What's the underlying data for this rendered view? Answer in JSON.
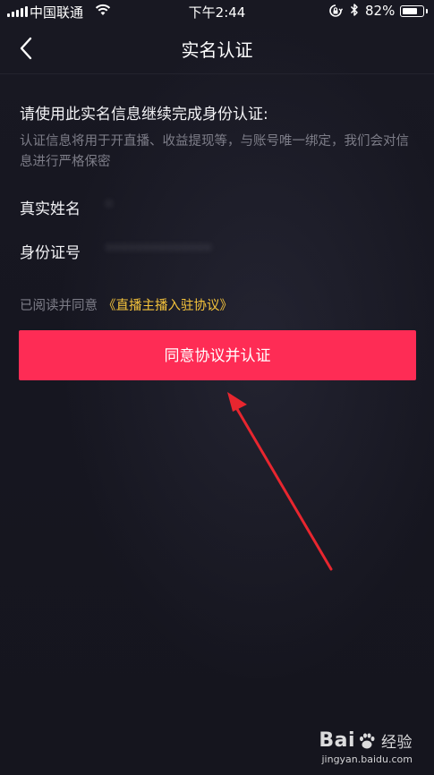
{
  "status_bar": {
    "carrier": "中国联通",
    "time": "下午2:44",
    "battery_percent": "82%",
    "battery_level": 0.82
  },
  "nav": {
    "title": "实名认证"
  },
  "main": {
    "heading": "请使用此实名信息继续完成身份认证:",
    "description": "认证信息将用于开直播、收益提现等，与账号唯一绑定，我们会对信息进行严格保密",
    "fields": [
      {
        "label": "真实姓名",
        "value": "*"
      },
      {
        "label": "身份证号",
        "value": "**************"
      }
    ],
    "agreement_prefix": "已阅读并同意",
    "agreement_link": "《直播主播入驻协议》",
    "submit_label": "同意协议并认证"
  },
  "watermark": {
    "logo": "Bai",
    "logo_suffix": "经验",
    "url": "jingyan.baidu.com"
  },
  "colors": {
    "background": "#15151f",
    "accent": "#fe2c55",
    "link": "#f5c33b",
    "annotation_arrow": "#e8262f"
  }
}
